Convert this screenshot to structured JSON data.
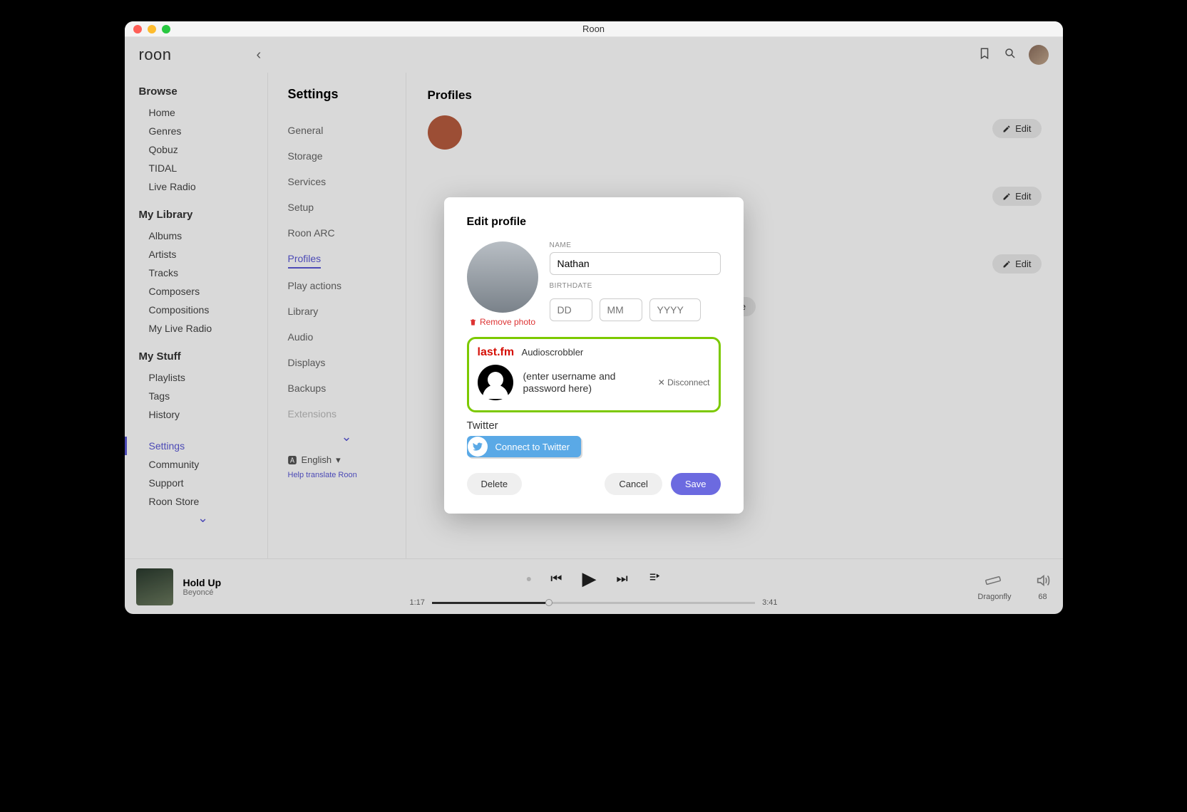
{
  "window": {
    "title": "Roon"
  },
  "logo": "roon",
  "sidebar": {
    "sections": [
      {
        "title": "Browse",
        "items": [
          "Home",
          "Genres",
          "Qobuz",
          "TIDAL",
          "Live Radio"
        ]
      },
      {
        "title": "My Library",
        "items": [
          "Albums",
          "Artists",
          "Tracks",
          "Composers",
          "Compositions",
          "My Live Radio"
        ]
      },
      {
        "title": "My Stuff",
        "items": [
          "Playlists",
          "Tags",
          "History"
        ]
      },
      {
        "title": "",
        "items": [
          "Settings",
          "Community",
          "Support",
          "Roon Store"
        ]
      }
    ],
    "active": "Settings"
  },
  "settings": {
    "heading": "Settings",
    "items": [
      "General",
      "Storage",
      "Services",
      "Setup",
      "Roon ARC",
      "Profiles",
      "Play actions",
      "Library",
      "Audio",
      "Displays",
      "Backups",
      "Extensions"
    ],
    "active": "Profiles",
    "language": "English",
    "translate": "Help translate Roon"
  },
  "main": {
    "heading": "Profiles",
    "edit_label": "Edit",
    "add_profile": "+ Add profile"
  },
  "modal": {
    "title": "Edit profile",
    "remove_photo": "Remove photo",
    "name_label": "NAME",
    "name_value": "Nathan",
    "birth_label": "BIRTHDATE",
    "dd": "DD",
    "mm": "MM",
    "yyyy": "YYYY",
    "lastfm_brand": "last.fm",
    "lastfm_sub": "Audioscrobbler",
    "lastfm_hint": "(enter username and password here)",
    "disconnect": "Disconnect",
    "twitter_label": "Twitter",
    "twitter_btn": "Connect to Twitter",
    "delete": "Delete",
    "cancel": "Cancel",
    "save": "Save"
  },
  "player": {
    "track": "Hold Up",
    "artist": "Beyoncé",
    "elapsed": "1:17",
    "total": "3:41",
    "output": "Dragonfly",
    "volume": "68"
  }
}
